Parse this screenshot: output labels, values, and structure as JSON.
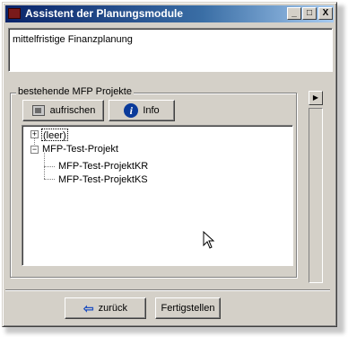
{
  "window": {
    "title": "Assistent der Planungsmodule",
    "minimize_glyph": "_",
    "maximize_glyph": "□",
    "close_glyph": "X"
  },
  "description": {
    "text": "mittelfristige Finanzplanung"
  },
  "group": {
    "label": "bestehende MFP Projekte",
    "refresh_label": "aufrischen",
    "info_label": "Info",
    "info_icon_glyph": "i"
  },
  "tree": {
    "nodes": [
      {
        "label": "(leer)",
        "expander": "+",
        "selected": true
      },
      {
        "label": "MFP-Test-Projekt",
        "expander": "−"
      },
      {
        "label": "MFP-Test-ProjektKR"
      },
      {
        "label": "MFP-Test-ProjektKS"
      }
    ]
  },
  "side": {
    "arrow_glyph": "▶"
  },
  "footer": {
    "back_label": "zurück",
    "back_icon_glyph": "⇦",
    "finish_label": "Fertigstellen"
  },
  "icons": {
    "title_icon": "app-icon",
    "refresh_icon": "refresh-icon",
    "info_icon": "info-icon",
    "back_icon": "back-arrow-icon"
  }
}
